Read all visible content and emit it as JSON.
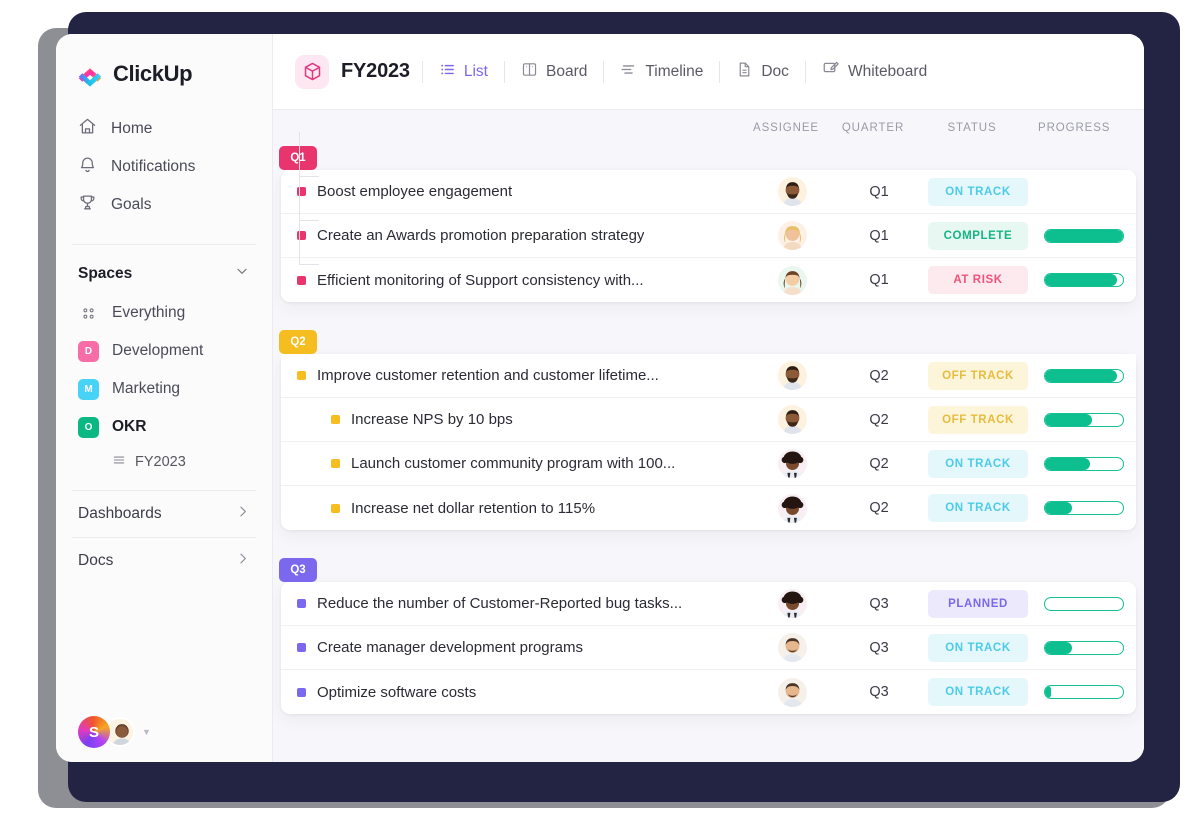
{
  "brand": {
    "name": "ClickUp"
  },
  "sidebar": {
    "nav": [
      {
        "label": "Home",
        "icon": "home-icon"
      },
      {
        "label": "Notifications",
        "icon": "bell-icon"
      },
      {
        "label": "Goals",
        "icon": "trophy-icon"
      }
    ],
    "spaces_header": "Spaces",
    "spaces": [
      {
        "label": "Everything",
        "icon": "dots-grid-icon",
        "initial": "",
        "color": ""
      },
      {
        "label": "Development",
        "initial": "D",
        "color": "#f86ca8"
      },
      {
        "label": "Marketing",
        "initial": "M",
        "color": "#48d2f5"
      },
      {
        "label": "OKR",
        "initial": "O",
        "color": "#0bb783",
        "active": true
      }
    ],
    "okr_lists": [
      {
        "label": "FY2023",
        "icon": "list-icon"
      }
    ],
    "collapsibles": [
      {
        "label": "Dashboards",
        "icon": "chevron-right-icon"
      },
      {
        "label": "Docs",
        "icon": "chevron-right-icon"
      }
    ],
    "user": {
      "initial": "S"
    }
  },
  "topbar": {
    "list_icon": "cube-icon",
    "title": "FY2023",
    "views": [
      {
        "label": "List",
        "icon": "list-view-icon",
        "active": true
      },
      {
        "label": "Board",
        "icon": "board-view-icon",
        "active": false
      },
      {
        "label": "Timeline",
        "icon": "timeline-view-icon",
        "active": false
      },
      {
        "label": "Doc",
        "icon": "doc-view-icon",
        "active": false
      },
      {
        "label": "Whiteboard",
        "icon": "whiteboard-view-icon",
        "active": false
      }
    ]
  },
  "columns": {
    "assignee": "ASSIGNEE",
    "quarter": "QUARTER",
    "status": "STATUS",
    "progress": "PROGRESS"
  },
  "status_styles": {
    "ON TRACK": {
      "bg": "#e4f7fb",
      "fg": "#4ecbe8"
    },
    "COMPLETE": {
      "bg": "#e6f8f1",
      "fg": "#16b483"
    },
    "AT RISK": {
      "bg": "#fdeaef",
      "fg": "#f0527b"
    },
    "OFF TRACK": {
      "bg": "#fdf5da",
      "fg": "#e7bc3e"
    },
    "PLANNED": {
      "bg": "#ebe9fb",
      "fg": "#7b68ee"
    }
  },
  "groups": [
    {
      "tag": "Q1",
      "tag_color": "#e8356d",
      "bullet_color": "#e8356d",
      "tasks": [
        {
          "title": "Boost employee engagement",
          "quarter": "Q1",
          "status": "ON TRACK",
          "progress": null,
          "indent": 0,
          "avatar": "avatar-beard-man"
        },
        {
          "title": "Create an Awards promotion preparation strategy",
          "quarter": "Q1",
          "status": "COMPLETE",
          "progress": 100,
          "indent": 0,
          "avatar": "avatar-blonde-woman"
        },
        {
          "title": "Efficient monitoring of Support consistency with...",
          "quarter": "Q1",
          "status": "AT RISK",
          "progress": 92,
          "indent": 0,
          "avatar": "avatar-smiling-woman"
        }
      ]
    },
    {
      "tag": "Q2",
      "tag_color": "#f5bd1f",
      "bullet_color": "#f5bd1f",
      "tasks": [
        {
          "title": "Improve customer retention and customer lifetime...",
          "quarter": "Q2",
          "status": "OFF TRACK",
          "progress": 92,
          "indent": 0,
          "avatar": "avatar-beard-man"
        },
        {
          "title": "Increase NPS by 10 bps",
          "quarter": "Q2",
          "status": "OFF TRACK",
          "progress": 60,
          "indent": 1,
          "avatar": "avatar-beard-man"
        },
        {
          "title": "Launch customer community program with 100...",
          "quarter": "Q2",
          "status": "ON TRACK",
          "progress": 58,
          "indent": 1,
          "avatar": "avatar-afro-man"
        },
        {
          "title": "Increase net dollar retention to 115%",
          "quarter": "Q2",
          "status": "ON TRACK",
          "progress": 35,
          "indent": 1,
          "avatar": "avatar-afro-man"
        }
      ]
    },
    {
      "tag": "Q3",
      "tag_color": "#7b68ee",
      "bullet_color": "#7b68ee",
      "tasks": [
        {
          "title": "Reduce the number of Customer-Reported bug tasks...",
          "quarter": "Q3",
          "status": "PLANNED",
          "progress": 0,
          "indent": 0,
          "avatar": "avatar-afro-man"
        },
        {
          "title": "Create manager development programs",
          "quarter": "Q3",
          "status": "ON TRACK",
          "progress": 35,
          "indent": 0,
          "avatar": "avatar-short-hair-man"
        },
        {
          "title": "Optimize software costs",
          "quarter": "Q3",
          "status": "ON TRACK",
          "progress": 8,
          "indent": 0,
          "avatar": "avatar-short-hair-man"
        }
      ]
    }
  ]
}
